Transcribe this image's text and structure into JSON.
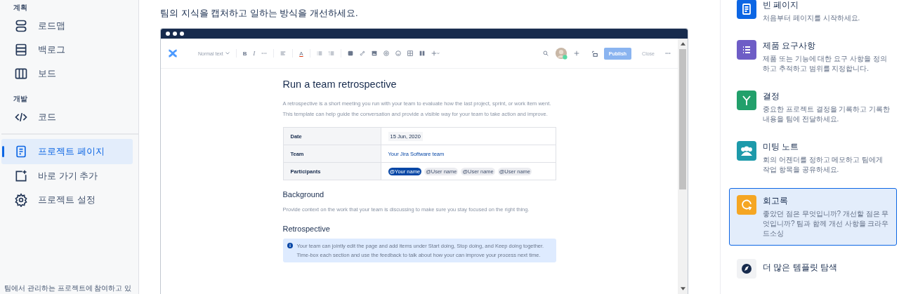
{
  "sidebar": {
    "groups": [
      {
        "heading": "계획",
        "items": [
          {
            "label": "로드맵",
            "selected": false
          },
          {
            "label": "백로그",
            "selected": false
          },
          {
            "label": "보드",
            "selected": false
          }
        ]
      },
      {
        "heading": "개발",
        "items": [
          {
            "label": "코드",
            "selected": false
          }
        ]
      },
      {
        "items": [
          {
            "label": "프로젝트 페이지",
            "selected": true
          },
          {
            "label": "바로 가기 추가",
            "selected": false
          },
          {
            "label": "프로젝트 설정",
            "selected": false
          }
        ]
      }
    ],
    "footer": "팀에서 관리하는 프로젝트에 참여하고 있"
  },
  "main": {
    "intro": "팀의 지식을 캡처하고 일하는 방식을 개선하세요.",
    "preview": {
      "toolbar": {
        "format": "Normal text",
        "bold": "B",
        "italic": "I",
        "text_color": "A",
        "publish": "Publish",
        "close": "Close"
      },
      "title": "Run a team retrospective",
      "description": "A retrospective is a short meeting you run with your team to evaluate how the last project, sprint, or work item went. This template can help guide the conversation and provide a visible way for your team to take action and improve.",
      "table": [
        {
          "label": "Date",
          "kind": "date",
          "value": "15 Jun, 2020"
        },
        {
          "label": "Team",
          "kind": "link",
          "value": "Your Jira Software team"
        },
        {
          "label": "Participants",
          "kind": "mentions",
          "mentions": [
            {
              "text": "@Your name",
              "highlighted": true
            },
            {
              "text": "@User name",
              "highlighted": false
            },
            {
              "text": "@User name",
              "highlighted": false
            },
            {
              "text": "@User name",
              "highlighted": false
            }
          ]
        }
      ],
      "sections": [
        {
          "heading": "Background",
          "text": "Provide context on the work that your team is discussing to make sure you stay focused on the right thing."
        },
        {
          "heading": "Retrospective"
        }
      ],
      "info": "Your team can jointly edit the page and add items under Start doing, Stop doing, and Keep doing together. Time-box each section and use the feedback to talk about how your can improve your process next time."
    }
  },
  "templates": [
    {
      "kind": "template",
      "title": "빈 페이지",
      "description": "처음부터 페이지를 시작하세요.",
      "color": "#0c66e4",
      "selected": false
    },
    {
      "kind": "template",
      "title": "제품 요구사항",
      "description": "제품 또는 기능에 대한 요구 사항을 정의하고 추적하고 범위를 지정합니다.",
      "color": "#6e5dc6",
      "selected": false
    },
    {
      "kind": "template",
      "title": "결정",
      "description": "중요한 프로젝트 결정을 기록하고 기록한 내용을 팀에 전달하세요.",
      "color": "#22a06b",
      "selected": false
    },
    {
      "kind": "template",
      "title": "미팅 노트",
      "description": "회의 어젠더를 정하고 메모하고 팀에게 작업 항목을 공유하세요.",
      "color": "#1d9aaa",
      "selected": false
    },
    {
      "kind": "template",
      "title": "회고록",
      "description": "좋았던 점은 무엇입니까? 개선할 점은 무엇입니까? 팀과 함께 개선 사항을 크라우드소싱",
      "color": "#f5a623",
      "selected": true
    },
    {
      "kind": "browse",
      "title": "더 많은 템플릿 탐색",
      "selected": false
    }
  ]
}
